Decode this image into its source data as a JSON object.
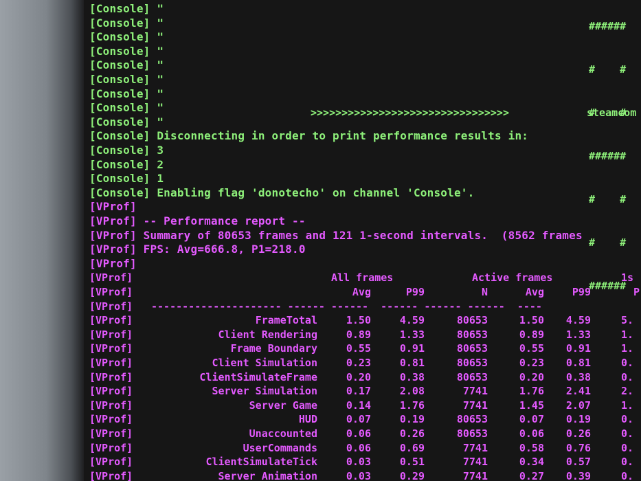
{
  "console_lines": [
    {
      "tag": "[Console]",
      "text": " \""
    },
    {
      "tag": "[Console]",
      "text": " \""
    },
    {
      "tag": "[Console]",
      "text": " \""
    },
    {
      "tag": "[Console]",
      "text": " \""
    },
    {
      "tag": "[Console]",
      "text": " \""
    },
    {
      "tag": "[Console]",
      "text": " \""
    },
    {
      "tag": "[Console]",
      "text": " \""
    },
    {
      "tag": "[Console]",
      "text": " \""
    },
    {
      "tag": "[Console]",
      "text": " \""
    },
    {
      "tag": "[Console]",
      "text": " Disconnecting in order to print performance results in:"
    },
    {
      "tag": "[Console]",
      "text": " 3"
    },
    {
      "tag": "[Console]",
      "text": " 2"
    },
    {
      "tag": "[Console]",
      "text": " 1"
    },
    {
      "tag": "[Console]",
      "text": " Enabling flag 'donotecho' on channel 'Console'."
    }
  ],
  "ascii_art": {
    "lines": [
      "######",
      "#    #",
      "#    #",
      "######",
      "#    #",
      "#    #",
      "######"
    ],
    "arrow": ">>>>>>>>>>>>>>>>>>>>>>>>>>>>>>>>",
    "steam_text": "steamcom"
  },
  "vprof_header": [
    {
      "tag": "[VProf]",
      "text": ""
    },
    {
      "tag": "[VProf]",
      "text": " -- Performance report --"
    },
    {
      "tag": "[VProf]",
      "text": " Summary of 80653 frames and 121 1-second intervals.  (8562 frames"
    },
    {
      "tag": "[VProf]",
      "text": " FPS: Avg=666.8, P1=218.0"
    },
    {
      "tag": "[VProf]",
      "text": ""
    }
  ],
  "table": {
    "tag": "[VProf]",
    "group_headers": {
      "all": "All frames",
      "active": "Active frames",
      "onesec": "1s"
    },
    "columns": {
      "avg": "Avg",
      "p99": "P99",
      "n": "N",
      "active_avg": "Avg",
      "active_p99": "P99",
      "onesec_p": "P"
    },
    "separator": "--------------------- ------ ------  ------ ------ ------  ----",
    "rows": [
      {
        "label": "FrameTotal",
        "avg": "1.50",
        "p99": "4.59",
        "n": "80653",
        "a_avg": "1.50",
        "a_p99": "4.59",
        "s": "5."
      },
      {
        "label": "Client Rendering",
        "avg": "0.89",
        "p99": "1.33",
        "n": "80653",
        "a_avg": "0.89",
        "a_p99": "1.33",
        "s": "1."
      },
      {
        "label": "Frame Boundary",
        "avg": "0.55",
        "p99": "0.91",
        "n": "80653",
        "a_avg": "0.55",
        "a_p99": "0.91",
        "s": "1."
      },
      {
        "label": "Client Simulation",
        "avg": "0.23",
        "p99": "0.81",
        "n": "80653",
        "a_avg": "0.23",
        "a_p99": "0.81",
        "s": "0."
      },
      {
        "label": "ClientSimulateFrame",
        "avg": "0.20",
        "p99": "0.38",
        "n": "80653",
        "a_avg": "0.20",
        "a_p99": "0.38",
        "s": "0."
      },
      {
        "label": "Server Simulation",
        "avg": "0.17",
        "p99": "2.08",
        "n": "7741",
        "a_avg": "1.76",
        "a_p99": "2.41",
        "s": "2."
      },
      {
        "label": "Server Game",
        "avg": "0.14",
        "p99": "1.76",
        "n": "7741",
        "a_avg": "1.45",
        "a_p99": "2.07",
        "s": "1."
      },
      {
        "label": "HUD",
        "avg": "0.07",
        "p99": "0.19",
        "n": "80653",
        "a_avg": "0.07",
        "a_p99": "0.19",
        "s": "0."
      },
      {
        "label": "Unaccounted",
        "avg": "0.06",
        "p99": "0.26",
        "n": "80653",
        "a_avg": "0.06",
        "a_p99": "0.26",
        "s": "0."
      },
      {
        "label": "UserCommands",
        "avg": "0.06",
        "p99": "0.69",
        "n": "7741",
        "a_avg": "0.58",
        "a_p99": "0.76",
        "s": "0."
      },
      {
        "label": "ClientSimulateTick",
        "avg": "0.03",
        "p99": "0.51",
        "n": "7741",
        "a_avg": "0.34",
        "a_p99": "0.57",
        "s": "0."
      },
      {
        "label": "Server Animation",
        "avg": "0.03",
        "p99": "0.29",
        "n": "7741",
        "a_avg": "0.27",
        "a_p99": "0.39",
        "s": "0."
      }
    ]
  },
  "colors": {
    "console_green": "#8ef07a",
    "vprof_magenta": "#e45aff",
    "background": "#161616"
  }
}
